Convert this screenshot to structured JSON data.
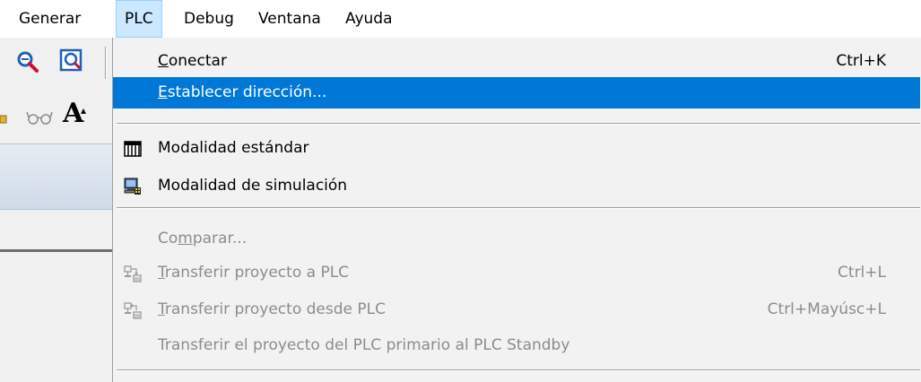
{
  "menubar": {
    "items": [
      "Generar",
      "PLC",
      "Debug",
      "Ventana",
      "Ayuda"
    ],
    "active_index": 1
  },
  "plc_menu": {
    "items": [
      {
        "pre": "",
        "mnemonic": "C",
        "post": "onectar",
        "shortcut": "Ctrl+K",
        "enabled": true,
        "highlighted": false,
        "icon": ""
      },
      {
        "pre": "",
        "mnemonic": "E",
        "post": "stablecer dirección...",
        "shortcut": "",
        "enabled": true,
        "highlighted": true,
        "icon": ""
      },
      {
        "pre": "",
        "mnemonic": "",
        "post": "Modalidad estándar",
        "shortcut": "",
        "enabled": true,
        "highlighted": false,
        "icon": "standard-mode-icon"
      },
      {
        "pre": "",
        "mnemonic": "",
        "post": "Modalidad de simulación",
        "shortcut": "",
        "enabled": true,
        "highlighted": false,
        "icon": "simulation-mode-icon"
      },
      {
        "pre": "Co",
        "mnemonic": "m",
        "post": "parar...",
        "shortcut": "",
        "enabled": false,
        "highlighted": false,
        "icon": ""
      },
      {
        "pre": "",
        "mnemonic": "T",
        "post": "ransferir proyecto a PLC",
        "shortcut": "Ctrl+L",
        "enabled": false,
        "highlighted": false,
        "icon": "transfer-to-plc-icon"
      },
      {
        "pre": "",
        "mnemonic": "T",
        "post": "ransferir proyecto desde PLC",
        "shortcut": "Ctrl+Mayúsc+L",
        "enabled": false,
        "highlighted": false,
        "icon": "transfer-from-plc-icon"
      },
      {
        "pre": "",
        "mnemonic": "",
        "post": "Transferir el proyecto del PLC primario al PLC Standby",
        "shortcut": "",
        "enabled": false,
        "highlighted": false,
        "icon": ""
      }
    ]
  },
  "toolbar": {
    "font_glyph": "A"
  },
  "colors": {
    "highlight": "#0078d7",
    "menu_active_bg": "#cce8ff",
    "disabled_text": "#8c8c8c"
  }
}
